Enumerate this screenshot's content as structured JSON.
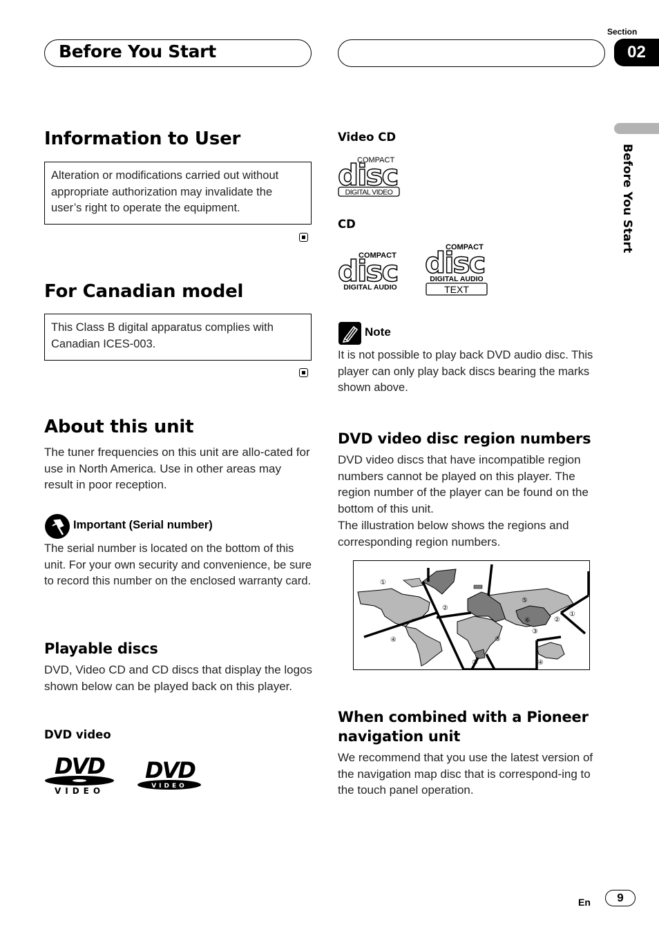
{
  "header": {
    "title": "Before You Start",
    "section_label": "Section",
    "section_number": "02"
  },
  "side_tab": {
    "label": "Before You Start"
  },
  "left": {
    "info_user": {
      "title": "Information to User",
      "box_text": "Alteration or modifications carried out without appropriate authorization may invalidate the user’s right to operate the equipment."
    },
    "canadian": {
      "title": "For Canadian model",
      "box_text": "This Class B digital apparatus complies with Canadian ICES-003."
    },
    "about": {
      "title": "About this unit",
      "body": "The tuner frequencies on this unit are allo-cated for use in North America. Use in other areas may result in poor reception.",
      "important_title": "Important (Serial number)",
      "important_body": "The serial number is located on the bottom of this unit. For your own security and convenience, be sure to record this number on the enclosed warranty card."
    },
    "playable": {
      "title": "Playable discs",
      "body": "DVD, Video CD and CD discs that display the logos shown below can be played back on this player.",
      "dvd_label": "DVD video",
      "dvd_logo_text": "DVD",
      "dvd_logo_sub": "VIDEO"
    }
  },
  "right": {
    "video_cd_label": "Video CD",
    "cd_label": "CD",
    "logo_compact": "COMPACT",
    "logo_disc": "disc",
    "logo_digital_video": "DIGITAL VIDEO",
    "logo_digital_audio": "DIGITAL AUDIO",
    "logo_text": "TEXT",
    "note_title": "Note",
    "note_body": "It is not possible to play back DVD audio disc. This player can only play back discs bearing the marks shown above.",
    "region": {
      "title": "DVD video disc region numbers",
      "body1": "DVD video discs that have incompatible region numbers cannot be played on this player. The region number of the player can be found on the bottom of this unit.",
      "body2": "The illustration below shows the regions and corresponding region numbers.",
      "map_labels": [
        "①",
        "②",
        "④",
        "⑤",
        "⑥",
        "③",
        "②",
        "①",
        "⑤",
        "②",
        "④"
      ]
    },
    "navigation": {
      "title": "When combined with a Pioneer navigation unit",
      "body": "We recommend that you use the latest version of the navigation map disc that is correspond-ing to the touch panel operation."
    }
  },
  "footer": {
    "lang": "En",
    "page": "9"
  },
  "colors": {
    "light_region": "#b8b8b8",
    "dark_region": "#7a7a7a",
    "side_tab": "#b3b3b3"
  }
}
